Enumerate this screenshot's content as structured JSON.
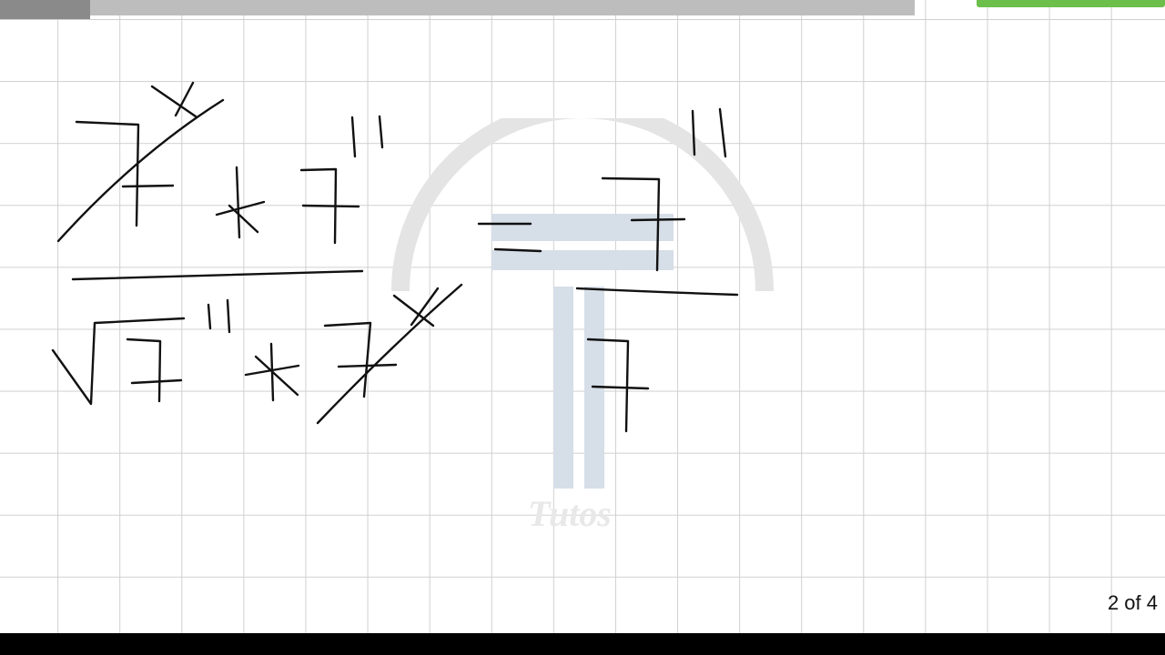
{
  "toolbar": {
    "accent_color": "#6cbf4a",
    "track_color": "#bdbdbd"
  },
  "watermark": {
    "text": "Tutos",
    "color": "#c5d0de"
  },
  "pager": {
    "label": "2 of 4"
  },
  "canvas": {
    "grid_color": "#d0d0d0",
    "ink_color": "#111111"
  }
}
